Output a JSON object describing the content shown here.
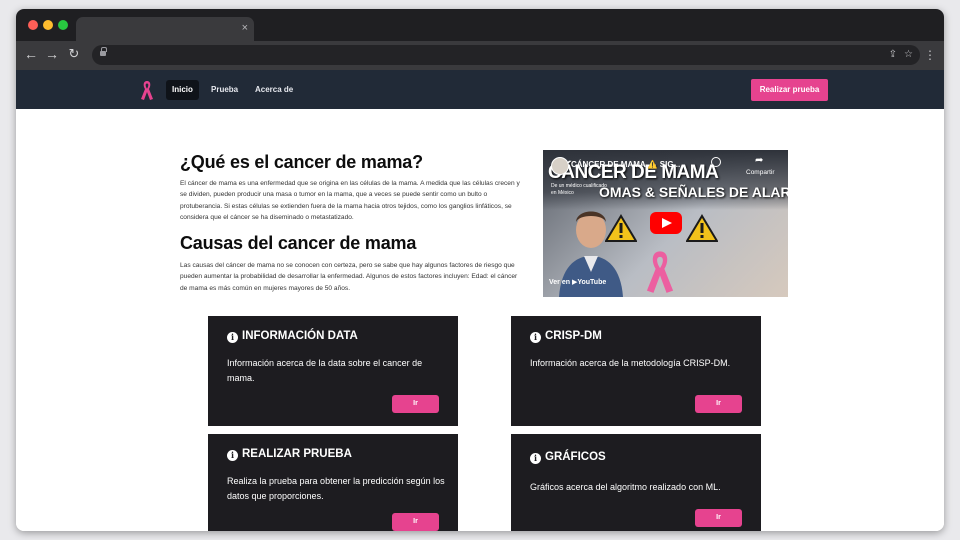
{
  "browser": {
    "tab": {
      "title": "",
      "close_glyph": "×"
    },
    "nav": {
      "back": "←",
      "forward": "→",
      "reload": "↻"
    },
    "address": {
      "value": ""
    },
    "icons": [
      "lock-icon",
      "share-icon",
      "bookmark-star-icon",
      "menu-dots-icon"
    ]
  },
  "nav": {
    "items": [
      {
        "label": "Inicio",
        "active": true
      },
      {
        "label": "Prueba",
        "active": false
      },
      {
        "label": "Acerca de",
        "active": false
      }
    ],
    "cta_label": "Realizar prueba",
    "colors": {
      "bar": "#212a37",
      "accent": "#e6438f"
    }
  },
  "intro": {
    "title": "¿Qué es el cancer de mama?",
    "text": "El cáncer de mama es una enfermedad que se origina en las células de la mama. A medida que las células crecen y se dividen, pueden producir una masa o tumor en la mama, que a veces se puede sentir como un bulto o protuberancia. Si estas células se extienden fuera de la mama hacia otros tejidos, como los ganglios linfáticos, se considera que el cáncer se ha diseminado o metastatizado."
  },
  "causes": {
    "title": "Causas del cancer de mama",
    "text": "Las causas del cáncer de mama no se conocen con certeza, pero se sabe que hay algunos factores de riesgo que pueden aumentar la probabilidad de desarrollar la enfermedad. Algunos de estos factores incluyen: Edad: el cáncer de mama es más común en mujeres mayores de 50 años."
  },
  "video": {
    "channel_title": "CÁNCER DE MAMA ⚠️ SIG...",
    "headline": "CÁNCER DE MAMA",
    "headline2": "OMAS & SEÑALES DE ALARMA",
    "subtitle": "De un médico cualificado en México",
    "share_label": "Compartir",
    "watch_on": "Ver en ▶YouTube"
  },
  "cards": [
    {
      "title": "INFORMACIÓN DATA",
      "text": "Información acerca de la data sobre el cancer de mama.",
      "button": "Ir"
    },
    {
      "title": "CRISP-DM",
      "text": "Información acerca de la metodología CRISP-DM.",
      "button": "Ir"
    },
    {
      "title": "REALIZAR PRUEBA",
      "text": "Realiza la prueba para obtener la predicción según los datos que proporciones.",
      "button": "Ir"
    },
    {
      "title": "GRÁFICOS",
      "text": "Gráficos acerca del algoritmo realizado con ML.",
      "button": "Ir"
    }
  ]
}
